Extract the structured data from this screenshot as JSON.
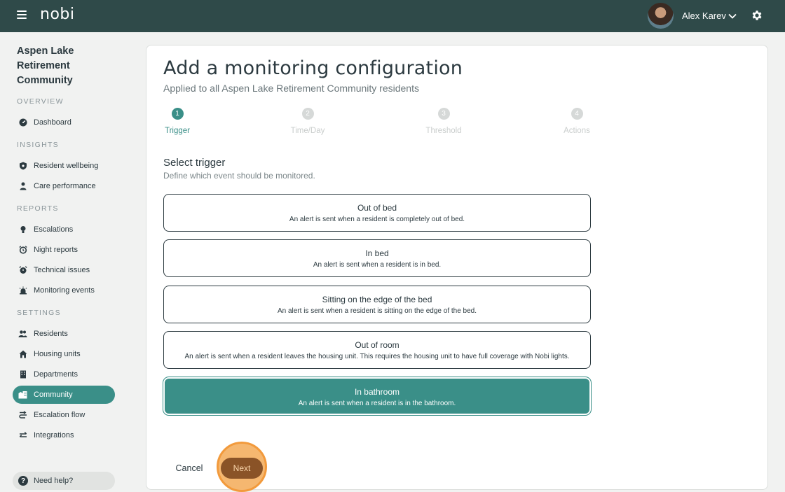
{
  "header": {
    "logo": "nobi",
    "user_name": "Alex Karev"
  },
  "sidebar": {
    "community_name": "Aspen Lake Retirement Community",
    "sections": {
      "overview": "OVERVIEW",
      "insights": "INSIGHTS",
      "reports": "REPORTS",
      "settings": "SETTINGS"
    },
    "items": {
      "dashboard": "Dashboard",
      "resident_wellbeing": "Resident wellbeing",
      "care_performance": "Care performance",
      "escalations": "Escalations",
      "night_reports": "Night reports",
      "technical_issues": "Technical issues",
      "monitoring_events": "Monitoring events",
      "residents": "Residents",
      "housing_units": "Housing units",
      "departments": "Departments",
      "community": "Community",
      "escalation_flow": "Escalation flow",
      "integrations": "Integrations"
    },
    "active_item": "community",
    "help": "Need help?"
  },
  "main": {
    "title": "Add a monitoring configuration",
    "subtitle": "Applied to all Aspen Lake Retirement Community residents",
    "steps": [
      {
        "number": "1",
        "label": "Trigger"
      },
      {
        "number": "2",
        "label": "Time/Day"
      },
      {
        "number": "3",
        "label": "Threshold"
      },
      {
        "number": "4",
        "label": "Actions"
      }
    ],
    "active_step": 1,
    "select_title": "Select trigger",
    "select_description": "Define which event should be monitored.",
    "options": [
      {
        "title": "Out of bed",
        "description": "An alert is sent when a resident is completely out of bed."
      },
      {
        "title": "In bed",
        "description": "An alert is sent when a resident is in bed."
      },
      {
        "title": "Sitting on the edge of the bed",
        "description": "An alert is sent when a resident is sitting on the edge of the bed."
      },
      {
        "title": "Out of room",
        "description": "An alert is sent when a resident leaves the housing unit. This requires the housing unit to have full coverage with Nobi lights."
      },
      {
        "title": "In bathroom",
        "description": "An alert is sent when a resident is in the bathroom."
      }
    ],
    "selected_option": 4,
    "cancel_label": "Cancel",
    "next_label": "Next"
  },
  "colors": {
    "header_bg": "#2f4a49",
    "accent": "#3a8f88",
    "next_button": "#8a5327",
    "highlight": "#f29a3c"
  }
}
